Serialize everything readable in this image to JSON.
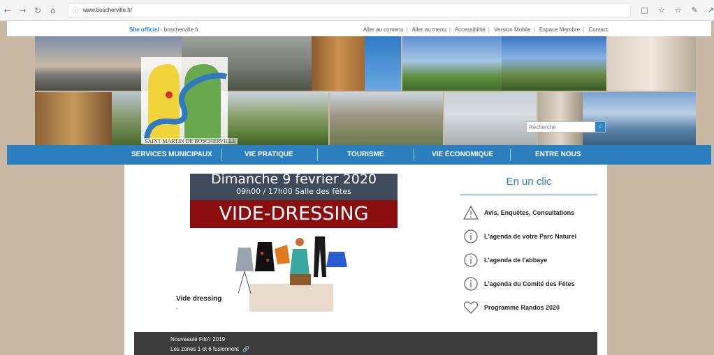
{
  "browser": {
    "url": "www.boscherville.fr/",
    "back_icon": "arrow-left-icon",
    "forward_icon": "arrow-right-icon",
    "reload_icon": "reload-icon",
    "home_icon": "home-icon"
  },
  "topbar": {
    "site_label": "Site officiel",
    "site_name": " - boscherville.fr",
    "links": [
      "Aller au contenu",
      "Aller au menu",
      "Accessibilité",
      "Version Mobile",
      "Espace Membre",
      "Contact"
    ]
  },
  "banner": {
    "logo_caption": "SAINT MARTIN DE BOSCHERVILLE",
    "search_placeholder": "Recherche"
  },
  "nav": {
    "items": [
      "SERVICES MUNICIPAUX",
      "VIE PRATIQUE",
      "TOURISME",
      "VIE ÉCONOMIQUE",
      "ENTRE NOUS"
    ]
  },
  "poster": {
    "date_line": "Dimanche 9 fevrier 2020",
    "time_line": "09h00 / 17h00   Salle des fêtes",
    "event": "VIDE-DRESSING"
  },
  "article": {
    "title": "Vide dressing",
    "sub": "-"
  },
  "sidebar": {
    "title": "En un clic",
    "items": [
      {
        "label": "Avis, Enquêtes, Consultations",
        "icon": "warning-icon"
      },
      {
        "label": "L'agenda de votre Parc Naturel",
        "icon": "info-icon"
      },
      {
        "label": "L'agenda de l'abbaye",
        "icon": "info-icon"
      },
      {
        "label": "L'agenda du Comité des Fêtes",
        "icon": "info-icon"
      },
      {
        "label": "Programme Randos 2020",
        "icon": "heart-icon"
      }
    ]
  },
  "news": {
    "title": "Nouveauté Filo'r 2019",
    "text": "Les zones 1 et 6 fusionnent"
  },
  "colors": {
    "nav_blue": "#2b7fbf",
    "poster_red": "#8b0d0d",
    "poster_header": "#3f4b5a",
    "page_bg": "#c9b8a3"
  }
}
